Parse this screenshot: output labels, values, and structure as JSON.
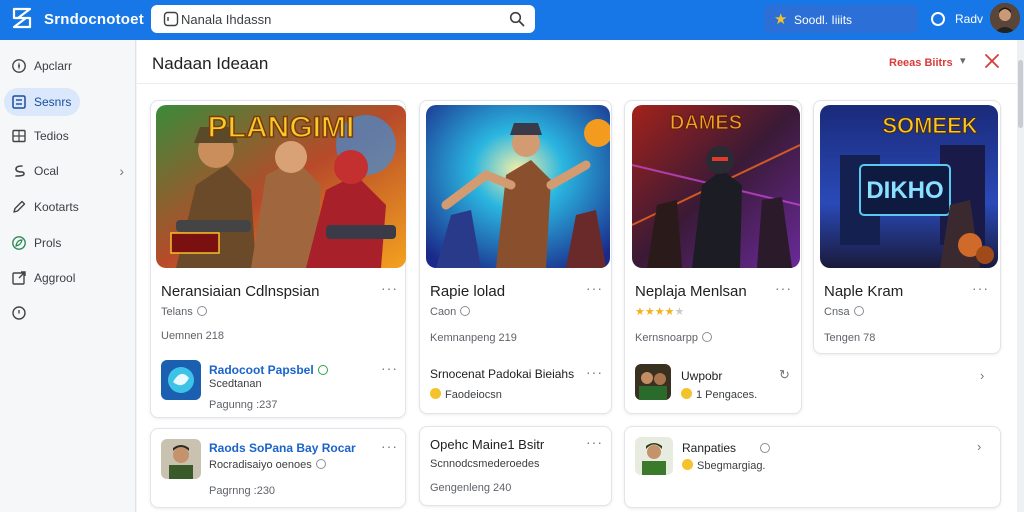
{
  "app": {
    "title": "Srndocnotoet",
    "brand_color": "#1877e6"
  },
  "search": {
    "value": "Nanala Ihdassn"
  },
  "points": {
    "label": "Soodl. Iiiits"
  },
  "user": {
    "name": "Radv"
  },
  "sidebar": {
    "items": [
      {
        "label": "Apclarr",
        "icon": "compass-icon"
      },
      {
        "label": "Sesnrs",
        "icon": "grid-icon",
        "active": true
      },
      {
        "label": "Tedios",
        "icon": "library-icon"
      },
      {
        "label": "Ocal",
        "icon": "link-icon",
        "has_chevron": true
      },
      {
        "label": "Kootarts",
        "icon": "pencil-icon"
      },
      {
        "label": "Prols",
        "icon": "leaf-icon"
      },
      {
        "label": "Aggrool",
        "icon": "external-link-icon"
      },
      {
        "label": "",
        "icon": "clock-icon"
      }
    ]
  },
  "main": {
    "title": "Nadaan Ideaan",
    "sort_label": "Reeas Biitrs",
    "cards": [
      {
        "title": "Neransiaian Cdlnspsian",
        "subtitle": "Telans",
        "meta": "Uemnen 218",
        "thumb_text": "PLANGIMI"
      },
      {
        "title": "Rapie lolad",
        "subtitle": "Caon",
        "meta": "Kemnanpeng 219"
      },
      {
        "title": "Neplaja Menlsan",
        "rating": 4,
        "meta": "Kernsnoarpp",
        "thumb_text": "DAMES"
      },
      {
        "title": "Naple Kram",
        "subtitle": "Cnsa",
        "meta": "Tengen 78",
        "thumb_text": "SOMEEK"
      }
    ],
    "dev_cards": [
      {
        "name": "Radocoot Papsbel",
        "sub": "Scedtanan",
        "meta": "Pagunng :237"
      },
      {
        "name": "Srnocenat Padokai Bieiahs",
        "sub": "Faodeiocsn"
      },
      {
        "name": "Uwpobr",
        "sub": "1 Pengaces."
      }
    ],
    "bottom_cards": [
      {
        "name": "Raods SoPana Bay Rocar",
        "sub": "Rocradisaiyo oenoes",
        "meta": "Pagrnng :230"
      },
      {
        "name": "Opehc Maine1 Bsitr",
        "sub": "Scnnodcsmederoedes",
        "meta": "Gengenleng 240"
      },
      {
        "name": "Ranpaties",
        "sub": "Sbegmargiag."
      }
    ]
  }
}
